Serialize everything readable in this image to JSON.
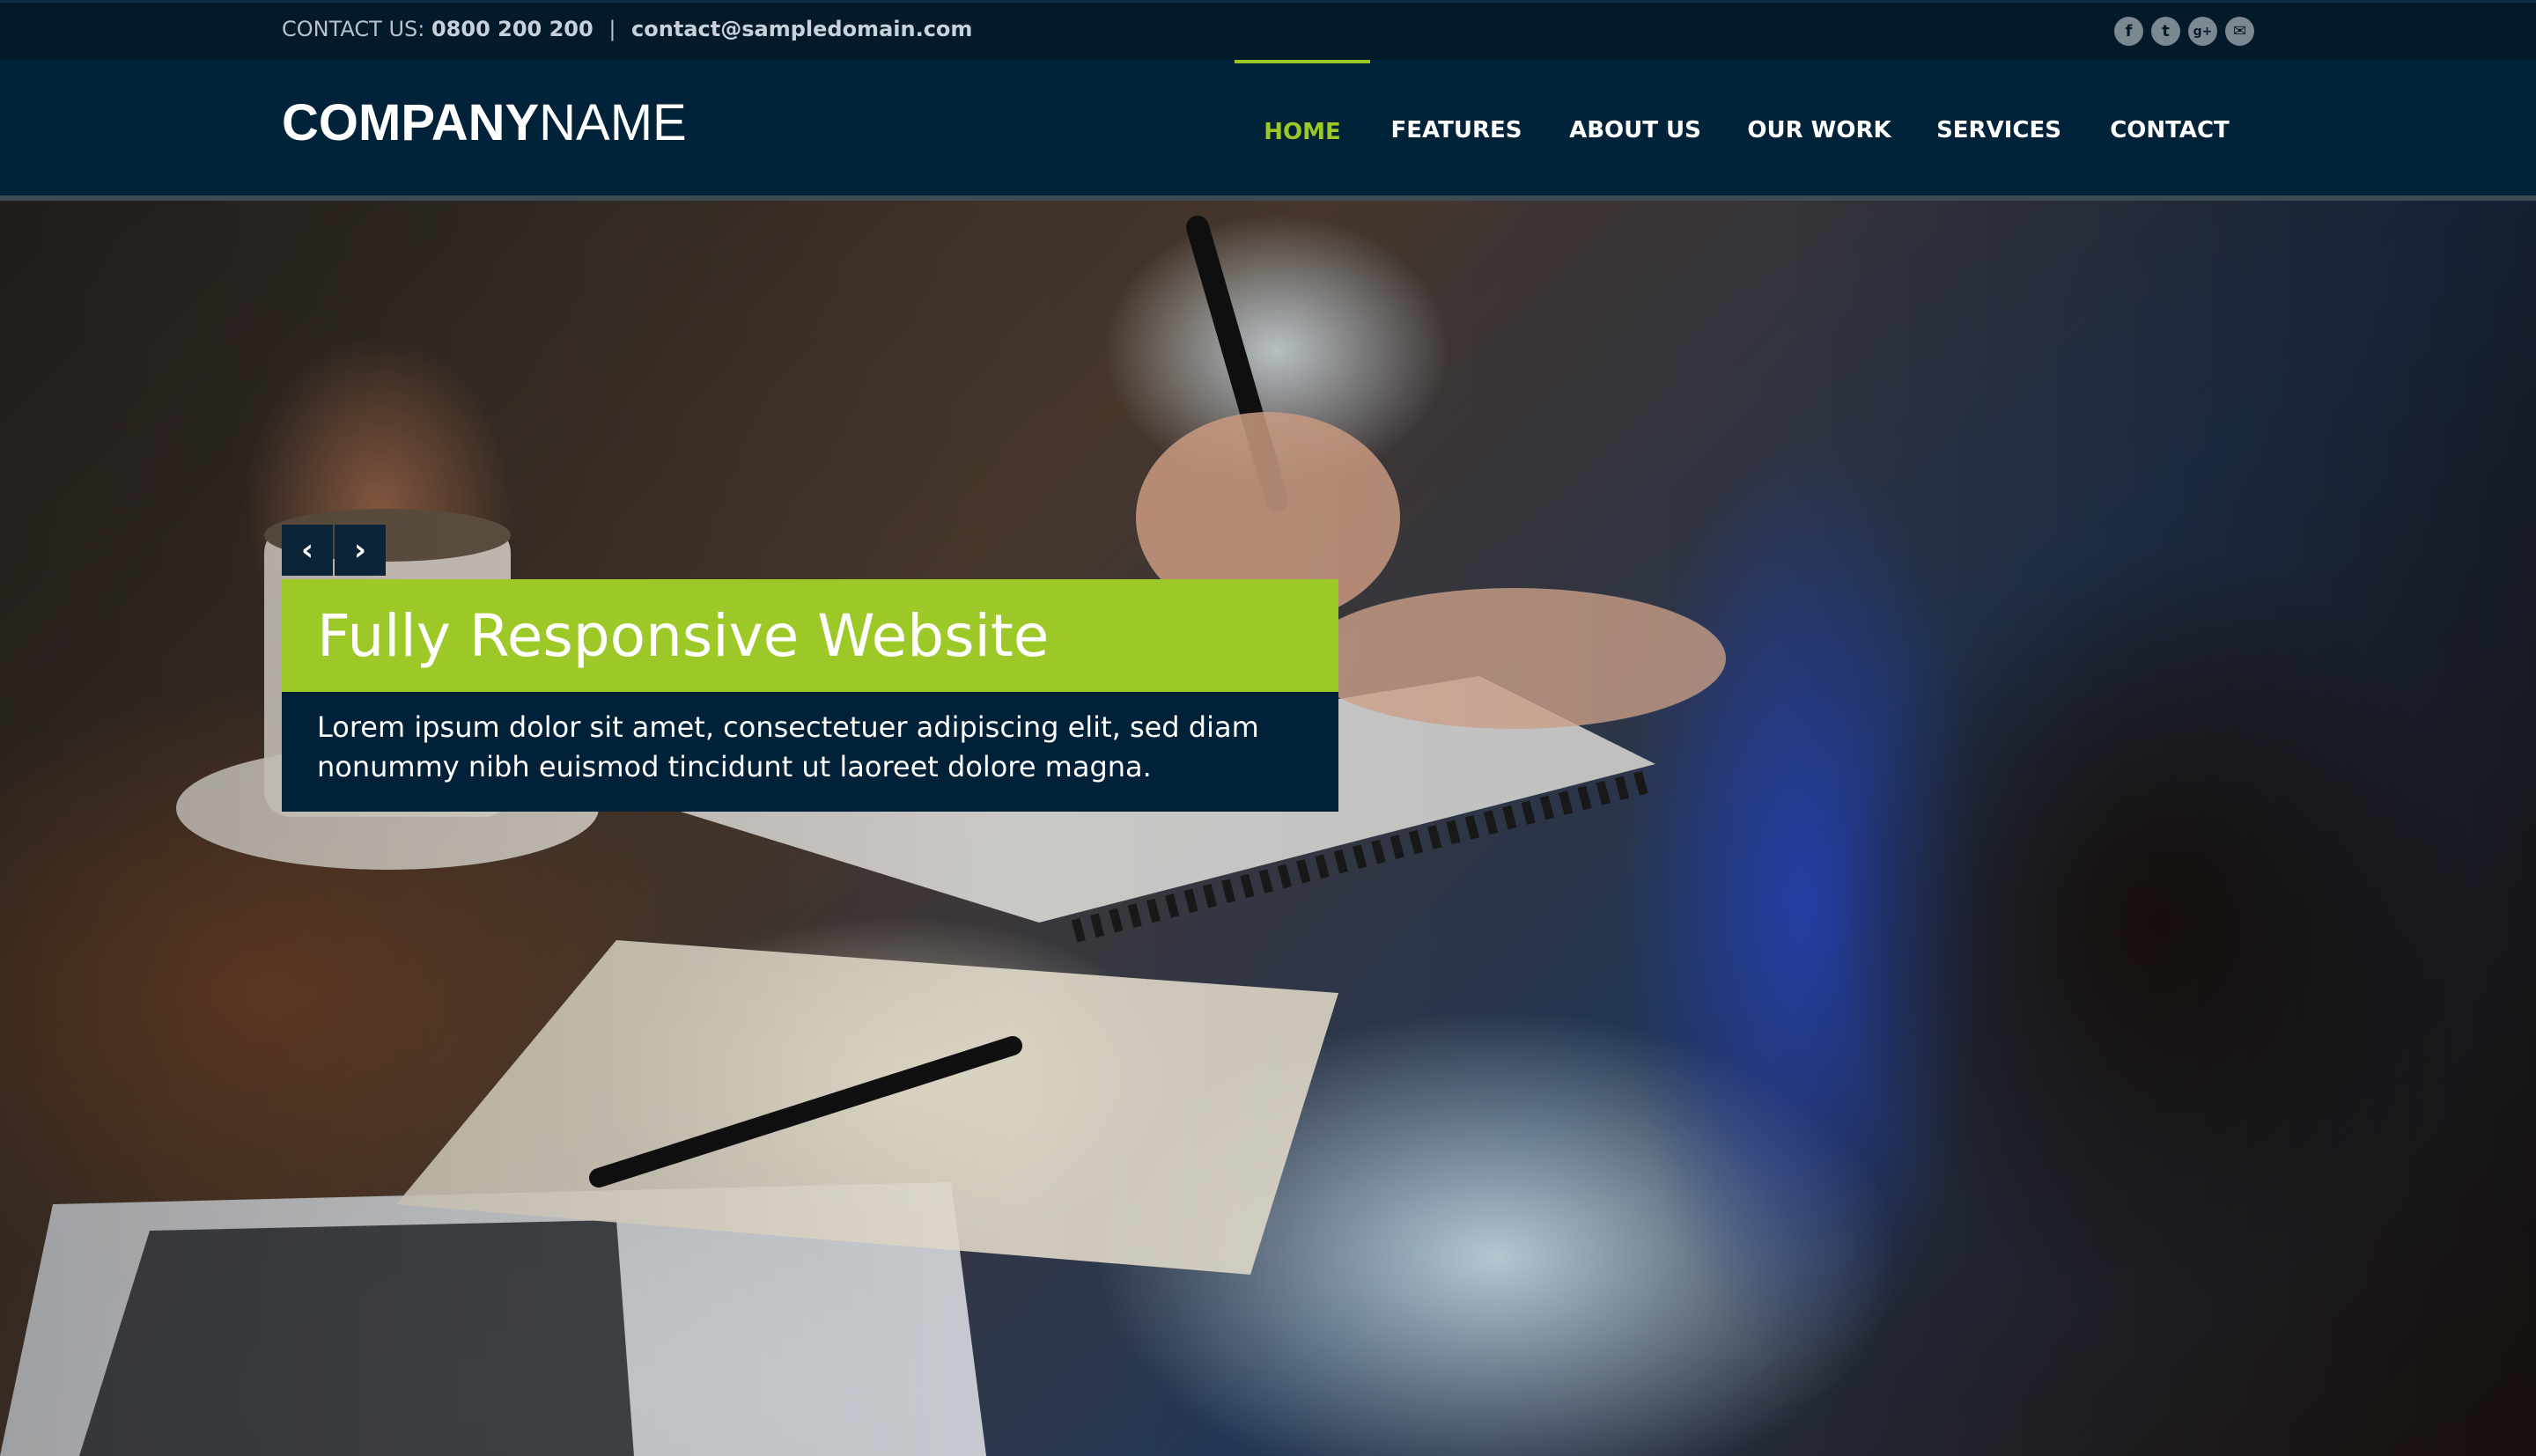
{
  "topbar": {
    "contact_label": "CONTACT US:",
    "phone": "0800 200 200",
    "separator": "|",
    "email": "contact@sampledomain.com",
    "social": [
      {
        "icon": "facebook-icon",
        "glyph": "f"
      },
      {
        "icon": "twitter-icon",
        "glyph": "t"
      },
      {
        "icon": "google-plus-icon",
        "glyph": "g+"
      },
      {
        "icon": "email-icon",
        "glyph": "✉"
      }
    ]
  },
  "header": {
    "logo_bold": "COMPANY",
    "logo_light": "NAME",
    "nav": [
      {
        "label": "HOME",
        "active": true
      },
      {
        "label": "FEATURES",
        "active": false
      },
      {
        "label": "ABOUT US",
        "active": false
      },
      {
        "label": "OUR WORK",
        "active": false
      },
      {
        "label": "SERVICES",
        "active": false
      },
      {
        "label": "CONTACT",
        "active": false
      }
    ]
  },
  "hero": {
    "prev_glyph": "‹",
    "next_glyph": "›",
    "title": "Fully Responsive Website",
    "description": "Lorem ipsum dolor sit amet, consectetuer adipiscing elit, sed diam nonummy nibh euismod tincidunt ut laoreet dolore magna."
  },
  "colors": {
    "accent": "#9cc828",
    "topbar_bg": "#021a29",
    "header_bg": "#01233a",
    "caption_bg": "#012138"
  }
}
